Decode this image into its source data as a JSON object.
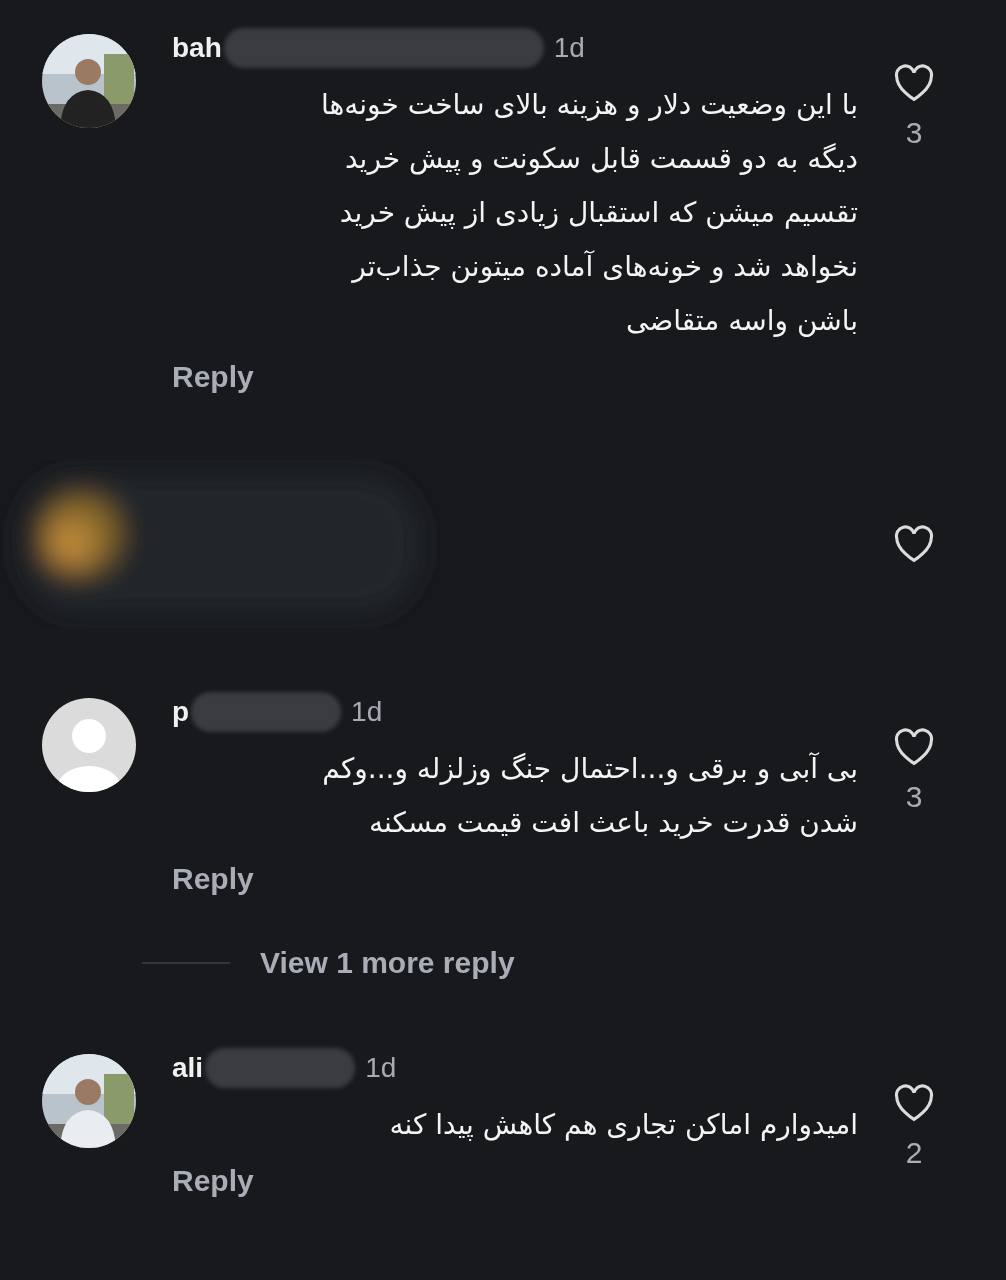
{
  "comments": [
    {
      "kind": "comment",
      "avatar_photo": true,
      "username": "bah",
      "username_redacted": true,
      "time": "1d",
      "text": "با این وضعیت دلار و هزینه بالای ساخت خونه‌ها\nدیگه به دو قسمت قابل سکونت و پیش خرید\nتقسیم میشن که استقبال زیادی از پیش خرید\nنخواهد شد و خونه‌های آماده میتونن جذاب‌تر\nباشن واسه متقاضی",
      "reply": "Reply",
      "likes": "3"
    },
    {
      "kind": "hidden"
    },
    {
      "kind": "comment",
      "avatar_photo": false,
      "username": "p",
      "username_redacted": true,
      "time": "1d",
      "text": "بی آبی و برقی و...احتمال جنگ وزلزله و...وکم\nشدن قدرت خرید باعث افت قیمت مسکنه",
      "reply": "Reply",
      "likes": "3",
      "more_replies": "View 1 more reply"
    },
    {
      "kind": "comment",
      "avatar_photo": true,
      "username": "ali",
      "username_redacted": true,
      "time": "1d",
      "text": "امیدوارم اماکن تجاری هم کاهش پیدا کنه",
      "reply": "Reply",
      "likes": "2"
    }
  ]
}
